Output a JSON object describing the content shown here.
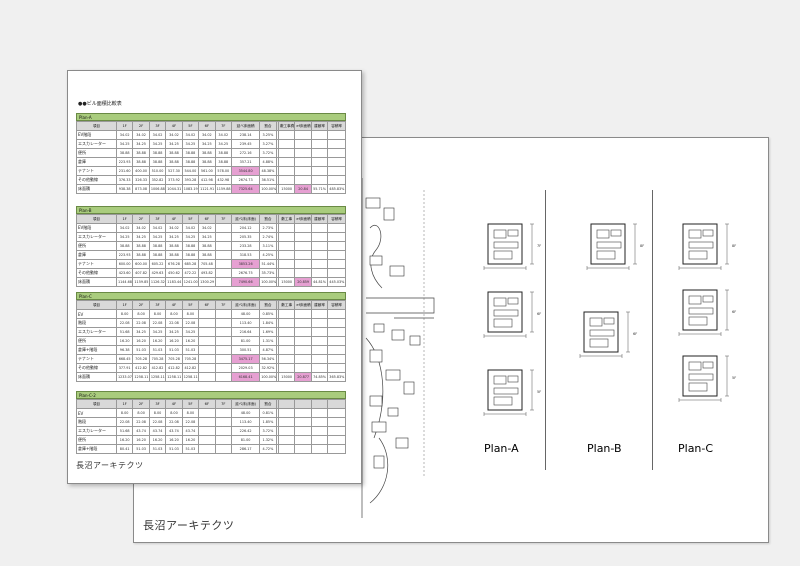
{
  "back_sheet": {
    "logo": "長沼アーキテクツ",
    "plans": [
      "Plan-A",
      "Plan-B",
      "Plan-C"
    ],
    "floor_tags": [
      "7F",
      "6F",
      "5F",
      "8F"
    ]
  },
  "front_sheet": {
    "title": "●●ビル面積比較表",
    "logo": "長沼アーキテクツ",
    "tables": [
      {
        "name": "Plan-A",
        "header": [
          "項目",
          "1F",
          "2F",
          "3F",
          "4F",
          "5F",
          "6F",
          "7F",
          "延べ床面積",
          "割合",
          "",
          "敷工事費",
          "ef床面積",
          "建蔽率",
          "容積率"
        ],
        "rows": [
          {
            "label": "EV階段",
            "cells": [
              "34.02",
              "34.02",
              "34.02",
              "34.02",
              "34.02",
              "34.02",
              "34.02",
              "238.14",
              "3.25%",
              "",
              "",
              "",
              "",
              ""
            ]
          },
          {
            "label": "エスカレーター",
            "cells": [
              "34.25",
              "34.25",
              "34.25",
              "34.25",
              "34.25",
              "34.25",
              "34.25",
              "239.45",
              "3.27%",
              "",
              "",
              "",
              "",
              ""
            ]
          },
          {
            "label": "便所",
            "cells": [
              "38.88",
              "38.88",
              "38.88",
              "38.88",
              "38.88",
              "38.88",
              "38.88",
              "272.16",
              "3.72%",
              "",
              "",
              "",
              "",
              ""
            ]
          },
          {
            "label": "倉庫",
            "cells": [
              "223.93",
              "38.88",
              "38.88",
              "38.88",
              "38.88",
              "38.88",
              "38.88",
              "357.21",
              "4.88%",
              "",
              "",
              "",
              "",
              ""
            ]
          },
          {
            "label": "テナント",
            "cells": [
              "231.60",
              "400.00",
              "510.00",
              "527.30",
              "544.00",
              "561.00",
              "578.00",
              "3544.80",
              "48.38%",
              "",
              "",
              "",
              "",
              ""
            ],
            "pink": [
              7
            ]
          },
          {
            "label": "その他動線",
            "cells": [
              "376.33",
              "326.33",
              "352.82",
              "373.92",
              "393.28",
              "412.98",
              "432.98",
              "2674.73",
              "36.51%",
              "",
              "",
              "",
              "",
              ""
            ]
          },
          {
            "label": "床面積",
            "cells": [
              "938.38",
              "873.08",
              "1006.88",
              "1044.31",
              "1083.19",
              "1121.91",
              "1159.88",
              "7325.64",
              "100.00%",
              "",
              "15000",
              "20.84",
              "55.71%",
              "485.83%"
            ],
            "pink": [
              7,
              11
            ]
          }
        ]
      },
      {
        "name": "Plan-B",
        "header": [
          "項目",
          "1F",
          "2F",
          "3F",
          "4F",
          "5F",
          "6F",
          "7F",
          "延べ床(床面)",
          "割合",
          "",
          "敷工事",
          "ef床面積",
          "建蔽率",
          "容積率"
        ],
        "rows": [
          {
            "label": "EV階段",
            "cells": [
              "34.02",
              "34.02",
              "34.02",
              "34.02",
              "34.02",
              "34.02",
              "",
              "204.12",
              "2.73%",
              "",
              "",
              "",
              "",
              ""
            ]
          },
          {
            "label": "エスカレーター",
            "cells": [
              "34.25",
              "34.25",
              "34.25",
              "34.25",
              "34.25",
              "34.25",
              "",
              "205.35",
              "2.74%",
              "",
              "",
              "",
              "",
              ""
            ]
          },
          {
            "label": "便所",
            "cells": [
              "38.88",
              "38.88",
              "38.88",
              "38.88",
              "38.88",
              "38.88",
              "",
              "233.28",
              "3.11%",
              "",
              "",
              "",
              "",
              ""
            ]
          },
          {
            "label": "倉庫",
            "cells": [
              "223.93",
              "38.88",
              "38.88",
              "38.88",
              "38.88",
              "38.88",
              "",
              "318.53",
              "4.25%",
              "",
              "",
              "",
              "",
              ""
            ]
          },
          {
            "label": "テナント",
            "cells": [
              "600.00",
              "600.00",
              "605.22",
              "676.28",
              "685.28",
              "705.48",
              "",
              "3853.26",
              "51.44%",
              "",
              "",
              "",
              "",
              ""
            ],
            "pink": [
              7
            ]
          },
          {
            "label": "その他動線",
            "cells": [
              "423.60",
              "407.82",
              "429.63",
              "450.62",
              "472.22",
              "493.82",
              "",
              "2676.75",
              "35.73%",
              "",
              "",
              "",
              "",
              ""
            ]
          },
          {
            "label": "床面積",
            "cells": [
              "1144.68",
              "1159.85",
              "1126.32",
              "1183.44",
              "1241.00",
              "1300.29",
              "",
              "7490.66",
              "100.00%",
              "",
              "15000",
              "20.859",
              "44.81%",
              "445.03%"
            ],
            "pink": [
              7,
              11
            ]
          }
        ]
      },
      {
        "name": "Plan-C",
        "header": [
          "項目",
          "1F",
          "2F",
          "3F",
          "4F",
          "5F",
          "6F",
          "7F",
          "延べ床(床面)",
          "割合",
          "",
          "敷工事",
          "ef床面積",
          "建蔽率",
          "容積率"
        ],
        "rows": [
          {
            "label": "EV",
            "cells": [
              "8.00",
              "8.00",
              "8.00",
              "8.00",
              "8.00",
              "",
              "",
              "48.00",
              "0.85%",
              "",
              "",
              "",
              "",
              ""
            ]
          },
          {
            "label": "階段",
            "cells": [
              "22.08",
              "22.08",
              "22.08",
              "22.08",
              "22.08",
              "",
              "",
              "113.40",
              "1.84%",
              "",
              "",
              "",
              "",
              ""
            ]
          },
          {
            "label": "エスカレーター",
            "cells": [
              "51.68",
              "34.25",
              "34.25",
              "34.25",
              "34.25",
              "",
              "",
              "216.64",
              "1.69%",
              "",
              "",
              "",
              "",
              ""
            ]
          },
          {
            "label": "便所",
            "cells": [
              "16.20",
              "16.20",
              "16.20",
              "16.20",
              "16.20",
              "",
              "",
              "81.00",
              "1.31%",
              "",
              "",
              "",
              "",
              ""
            ]
          },
          {
            "label": "倉庫+階段",
            "cells": [
              "96.38",
              "51.03",
              "51.03",
              "51.03",
              "51.03",
              "",
              "",
              "300.51",
              "4.87%",
              "",
              "",
              "",
              "",
              ""
            ]
          },
          {
            "label": "テナント",
            "cells": [
              "668.45",
              "705.28",
              "705.28",
              "705.28",
              "705.28",
              "",
              "",
              "3475.17",
              "56.34%",
              "",
              "",
              "",
              "",
              ""
            ],
            "pink": [
              7
            ]
          },
          {
            "label": "その他動線",
            "cells": [
              "377.91",
              "412.82",
              "412.82",
              "412.82",
              "412.82",
              "",
              "",
              "2029.03",
              "32.92%",
              "",
              "",
              "",
              "",
              ""
            ]
          },
          {
            "label": "床面積",
            "cells": [
              "1233.07",
              "1258.11",
              "1258.11",
              "1258.11",
              "1258.11",
              "",
              "",
              "6168.41",
              "100.00%",
              "",
              "15000",
              "20.877",
              "74.85%",
              "365.83%"
            ],
            "pink": [
              7,
              11
            ]
          }
        ]
      },
      {
        "name": "Plan-C-2",
        "header": [
          "項目",
          "1F",
          "2F",
          "3F",
          "4F",
          "5F",
          "6F",
          "7F",
          "延べ床(床面)",
          "割合",
          "",
          "",
          "",
          "",
          ""
        ],
        "rows": [
          {
            "label": "EV",
            "cells": [
              "8.00",
              "8.00",
              "8.00",
              "8.00",
              "8.00",
              "",
              "",
              "48.00",
              "0.81%",
              "",
              "",
              "",
              "",
              ""
            ]
          },
          {
            "label": "階段",
            "cells": [
              "22.08",
              "22.08",
              "22.08",
              "22.08",
              "22.08",
              "",
              "",
              "113.40",
              "1.85%",
              "",
              "",
              "",
              "",
              ""
            ]
          },
          {
            "label": "エスカレーター",
            "cells": [
              "51.68",
              "43.74",
              "43.74",
              "43.74",
              "43.74",
              "",
              "",
              "226.42",
              "3.72%",
              "",
              "",
              "",
              "",
              ""
            ]
          },
          {
            "label": "便所",
            "cells": [
              "16.20",
              "16.20",
              "16.20",
              "16.20",
              "16.20",
              "",
              "",
              "81.00",
              "1.32%",
              "",
              "",
              "",
              "",
              ""
            ]
          },
          {
            "label": "倉庫+階段",
            "cells": [
              "80.41",
              "51.03",
              "51.03",
              "51.03",
              "51.03",
              "",
              "",
              "286.17",
              "4.72%",
              "",
              "",
              "",
              "",
              ""
            ]
          }
        ]
      }
    ]
  }
}
